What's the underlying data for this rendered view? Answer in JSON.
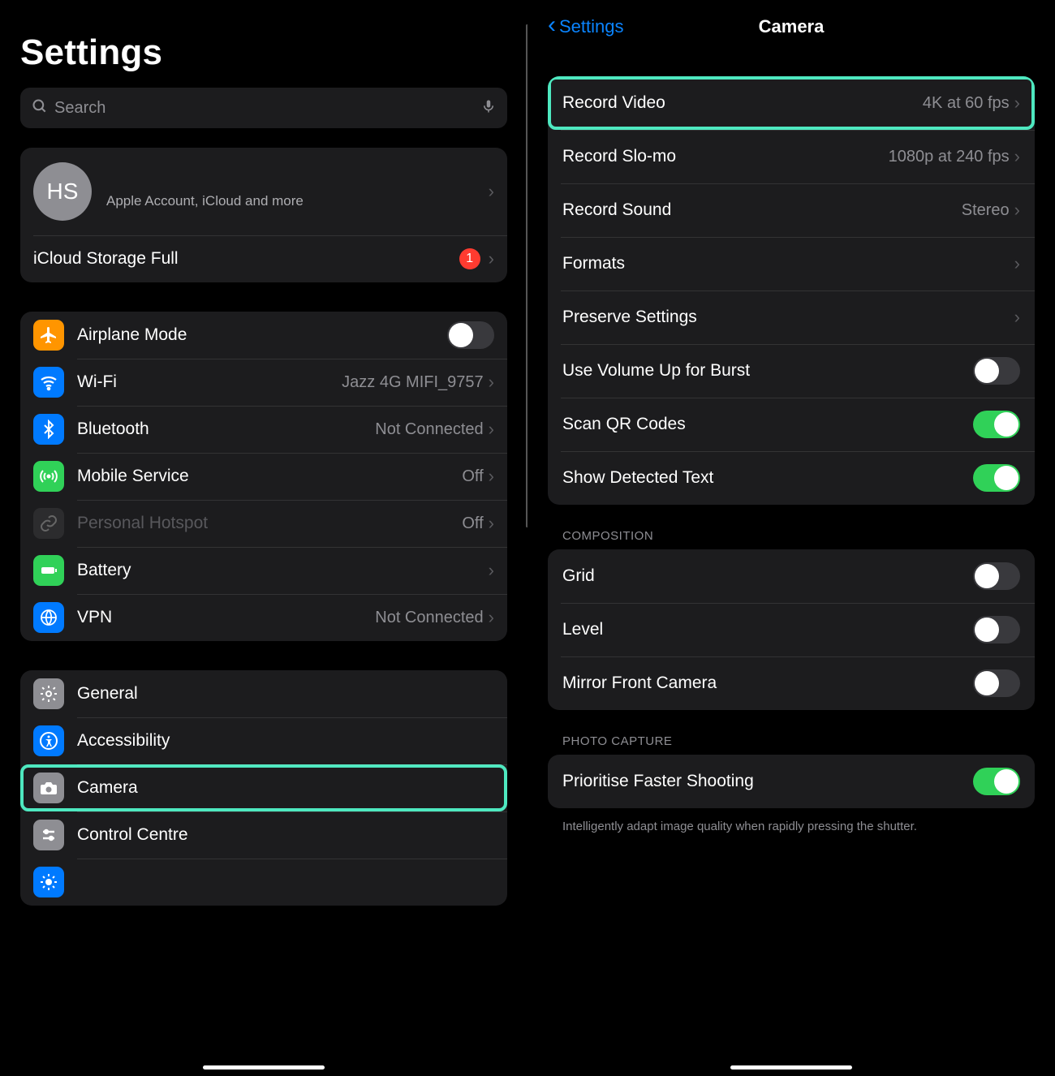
{
  "left": {
    "title": "Settings",
    "search_placeholder": "Search",
    "account": {
      "initials": "HS",
      "subtitle": "Apple Account, iCloud and more"
    },
    "icloud_row": {
      "label": "iCloud Storage Full",
      "badge": "1"
    },
    "group_net": [
      {
        "id": "airplane",
        "label": "Airplane Mode",
        "value": "",
        "toggle": "off",
        "color": "#ff9500",
        "icon": "airplane"
      },
      {
        "id": "wifi",
        "label": "Wi-Fi",
        "value": "Jazz 4G MIFI_9757",
        "chev": true,
        "color": "#007aff",
        "icon": "wifi"
      },
      {
        "id": "bluetooth",
        "label": "Bluetooth",
        "value": "Not Connected",
        "chev": true,
        "color": "#007aff",
        "icon": "bluetooth"
      },
      {
        "id": "mobile",
        "label": "Mobile Service",
        "value": "Off",
        "chev": true,
        "color": "#30d158",
        "icon": "antenna"
      },
      {
        "id": "hotspot",
        "label": "Personal Hotspot",
        "value": "Off",
        "chev": true,
        "color": "#2c2c2e",
        "icon": "link",
        "dim": true
      },
      {
        "id": "battery",
        "label": "Battery",
        "value": "",
        "chev": true,
        "color": "#30d158",
        "icon": "battery"
      },
      {
        "id": "vpn",
        "label": "VPN",
        "value": "Not Connected",
        "chev": true,
        "color": "#007aff",
        "icon": "globe"
      }
    ],
    "group_general": [
      {
        "id": "general",
        "label": "General",
        "color": "#8e8e93",
        "icon": "gear"
      },
      {
        "id": "accessibility",
        "label": "Accessibility",
        "color": "#007aff",
        "icon": "access"
      },
      {
        "id": "camera",
        "label": "Camera",
        "color": "#8e8e93",
        "icon": "camera",
        "highlight": true
      },
      {
        "id": "controlcentre",
        "label": "Control Centre",
        "color": "#8e8e93",
        "icon": "sliders"
      },
      {
        "id": "display",
        "label": "",
        "color": "#007aff",
        "icon": "brightness"
      }
    ]
  },
  "right": {
    "back_label": "Settings",
    "title": "Camera",
    "group_main": [
      {
        "id": "recvideo",
        "label": "Record Video",
        "value": "4K at 60 fps",
        "chev": true,
        "highlight": true
      },
      {
        "id": "recslomo",
        "label": "Record Slo-mo",
        "value": "1080p at 240 fps",
        "chev": true
      },
      {
        "id": "recsound",
        "label": "Record Sound",
        "value": "Stereo",
        "chev": true
      },
      {
        "id": "formats",
        "label": "Formats",
        "value": "",
        "chev": true
      },
      {
        "id": "preserve",
        "label": "Preserve Settings",
        "value": "",
        "chev": true
      },
      {
        "id": "volburst",
        "label": "Use Volume Up for Burst",
        "toggle": "off"
      },
      {
        "id": "qr",
        "label": "Scan QR Codes",
        "toggle": "on"
      },
      {
        "id": "detected",
        "label": "Show Detected Text",
        "toggle": "on"
      }
    ],
    "section_composition": "COMPOSITION",
    "group_comp": [
      {
        "id": "grid",
        "label": "Grid",
        "toggle": "off"
      },
      {
        "id": "level",
        "label": "Level",
        "toggle": "off"
      },
      {
        "id": "mirror",
        "label": "Mirror Front Camera",
        "toggle": "off"
      }
    ],
    "section_photo": "PHOTO CAPTURE",
    "group_photo": [
      {
        "id": "faster",
        "label": "Prioritise Faster Shooting",
        "toggle": "on"
      }
    ],
    "footer_faster": "Intelligently adapt image quality when rapidly pressing the shutter."
  }
}
